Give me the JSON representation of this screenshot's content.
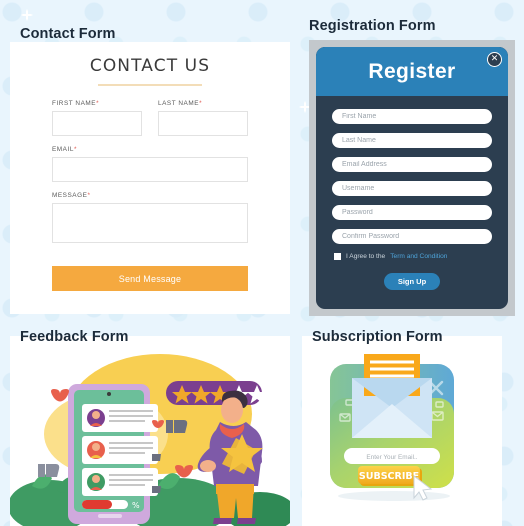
{
  "page": {
    "background_color": "#e9f5fd"
  },
  "sections": {
    "contact": {
      "title": "Contact Form",
      "heading": "CONTACT US",
      "fields": {
        "first_name": {
          "label": "FIRST NAME",
          "required_mark": "*",
          "value": "",
          "placeholder": ""
        },
        "last_name": {
          "label": "LAST NAME",
          "required_mark": "*",
          "value": "",
          "placeholder": ""
        },
        "email": {
          "label": "EMAIL",
          "required_mark": "*",
          "value": "",
          "placeholder": ""
        },
        "message": {
          "label": "MESSAGE",
          "required_mark": "*",
          "value": "",
          "placeholder": ""
        }
      },
      "submit_label": "Send Message",
      "accent_color": "#f5a93f",
      "rule_color": "#f3ddb8"
    },
    "registration": {
      "title": "Registration Form",
      "heading": "Register",
      "close_icon": "close-x-icon",
      "close_glyph": "✕",
      "header_color": "#2b81b8",
      "body_color": "#2c3e50",
      "fields": [
        {
          "name": "first-name",
          "placeholder": "First Name",
          "value": ""
        },
        {
          "name": "last-name",
          "placeholder": "Last Name",
          "value": ""
        },
        {
          "name": "email-address",
          "placeholder": "Email Address",
          "value": ""
        },
        {
          "name": "username",
          "placeholder": "Username",
          "value": ""
        },
        {
          "name": "password",
          "placeholder": "Password",
          "value": ""
        },
        {
          "name": "confirm-password",
          "placeholder": "Confirm Password",
          "value": ""
        }
      ],
      "agree_text": "I Agree to the",
      "agree_link": "Term and Condition",
      "agree_checked": false,
      "submit_label": "Sign Up",
      "link_color": "#4ea3d8"
    },
    "feedback": {
      "title": "Feedback Form",
      "illustration": {
        "name": "feedback-illustration",
        "rating_filled": 3,
        "rating_total": 5,
        "star_filled_color": "#f0a72a",
        "star_empty_color": "#ffffff",
        "rating_pill_color": "#7b3f8f",
        "review_count": 3,
        "progress_label": "%",
        "phone_screen_color": "#6cbf9a",
        "phone_frame_color": "#cfa9dd",
        "blob_color": "#f5c33f"
      }
    },
    "subscription": {
      "title": "Subscription Form",
      "illustration": {
        "name": "subscription-illustration",
        "email_placeholder": "Enter Your Email..",
        "button_label": "SUBSCRIBE",
        "button_color": "#f5c02a",
        "close_icon": "close-x-icon",
        "close_glyph": "✕",
        "cursor_icon": "mouse-pointer-icon",
        "panel_gradient_from": "#8fc98f",
        "panel_gradient_to": "#c2db4e",
        "envelope_flap_color": "#f9a81a",
        "envelope_body_color": "#cfe4f5"
      }
    }
  }
}
